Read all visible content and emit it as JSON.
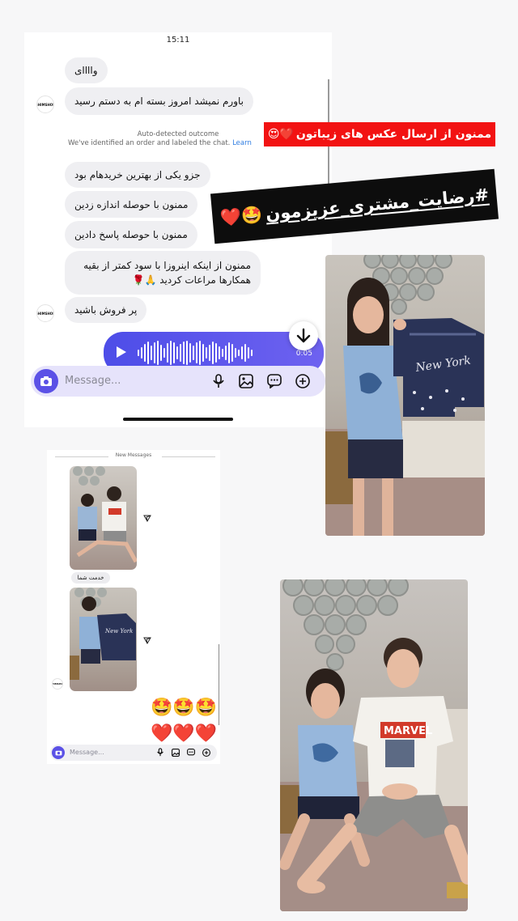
{
  "chat_main": {
    "time": "15:11",
    "messages": [
      {
        "text": "واااای"
      },
      {
        "text": "باورم نمیشد امروز بسته ام به دستم رسید"
      },
      {
        "text": "جزو یکی از بهترین خریدهام بود"
      },
      {
        "text": "ممنون با حوصله اندازه زدین"
      },
      {
        "text": "ممنون با حوصله پاسخ دادین"
      },
      {
        "text": "ممنون از اینکه اینروزا با سود کمتر از بقیه همکارها مراعات کردید 🙏🌹"
      },
      {
        "text": "پر فروش باشید"
      }
    ],
    "avatar_text": "SHIMSHOP",
    "auto_detected_title": "Auto-detected outcome",
    "auto_detected_desc": "We've identified an order and labeled the chat.",
    "auto_detected_link": "Learn",
    "voice_duration": "0:05",
    "composer_placeholder": "Message..."
  },
  "red_banner": {
    "text": "ممنون از ارسال عکس های زیباتون",
    "emoji": "❤️😍"
  },
  "black_banner": {
    "text": "#رضایت_مشتری_عزیزمون",
    "emoji": "🤩❤️"
  },
  "chat_small": {
    "new_messages_label": "New Messages",
    "reply_text": "خدمت شما",
    "avatar_text": "SHIMSHOP",
    "emoji_rows": [
      "🤩🤩🤩",
      "❤️❤️❤️"
    ],
    "composer_placeholder": "Message..."
  },
  "colors": {
    "accent": "#5b51e6",
    "voice_bubble": "#5b51e6",
    "red_banner": "#f21212",
    "bubble_gray": "#efeff2"
  }
}
